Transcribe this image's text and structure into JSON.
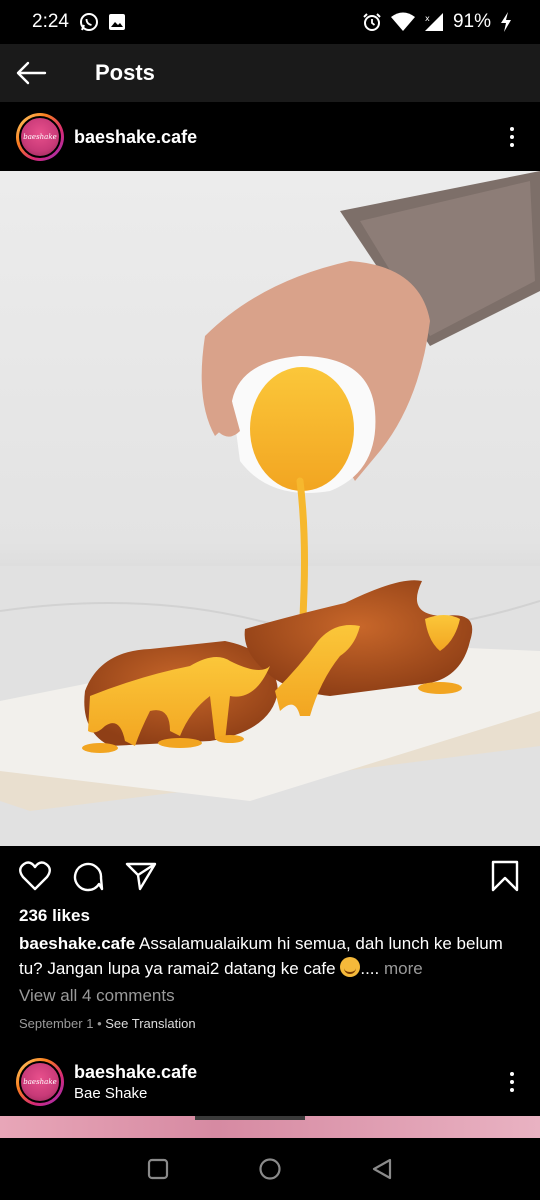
{
  "status_bar": {
    "time": "2:24",
    "battery": "91%",
    "icons": [
      "whatsapp-icon",
      "gallery-icon",
      "alarm-icon",
      "wifi-icon",
      "signal-icon",
      "charging-icon"
    ]
  },
  "app_bar": {
    "title": "Posts",
    "back_icon": "back-arrow-icon"
  },
  "post": {
    "username": "baeshake.cafe",
    "avatar_text": "baeshake",
    "image_alt": "Hand pouring cheese sauce over fried chicken",
    "likes": "236 likes",
    "caption_user": "baeshake.cafe",
    "caption_text": "Assalamualaikum hi semua, dah lunch ke belum tu? Jangan lupa ya ramai2 datang ke cafe",
    "caption_after_emoji": "....",
    "more_label": " more",
    "view_comments": "View all 4 comments",
    "date": "September 1",
    "separator": "•",
    "see_translation": "See Translation",
    "actions": [
      "heart-icon",
      "comment-icon",
      "share-icon",
      "bookmark-icon"
    ]
  },
  "next_post": {
    "username": "baeshake.cafe",
    "location": "Bae Shake",
    "avatar_text": "baeshake"
  },
  "nav_bar": {
    "buttons": [
      "recents-icon",
      "home-icon",
      "back-icon"
    ]
  },
  "colors": {
    "background": "#000000",
    "app_bar": "#1a1a1a",
    "secondary_text": "#9a9a9a",
    "avatar_pink": "#d63b7a",
    "sauce": "#f6b82e"
  }
}
